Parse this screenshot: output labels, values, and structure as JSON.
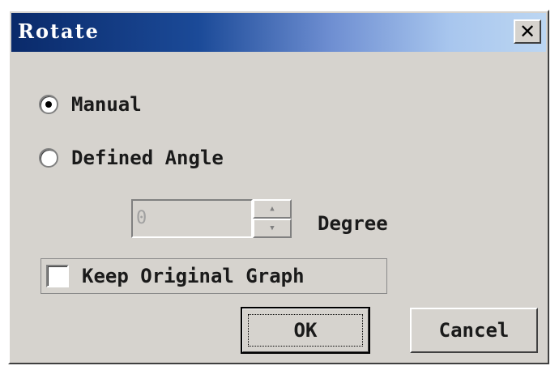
{
  "window": {
    "title": "Rotate",
    "close_symbol": "✕"
  },
  "options": {
    "manual_label": "Manual",
    "manual_selected": true,
    "defined_angle_label": "Defined Angle",
    "defined_angle_selected": false
  },
  "angle": {
    "value": "0",
    "unit_label": "Degree",
    "enabled": false,
    "up_symbol": "▲",
    "down_symbol": "▼"
  },
  "keep_original": {
    "label": "Keep Original Graph",
    "checked": false
  },
  "buttons": {
    "ok_label": "OK",
    "cancel_label": "Cancel"
  },
  "colors": {
    "dialog_face": "#d6d3ce",
    "title_gradient_start": "#0a2a6a",
    "title_gradient_end": "#bcd6f2",
    "disabled_text": "#a0a0a0"
  }
}
